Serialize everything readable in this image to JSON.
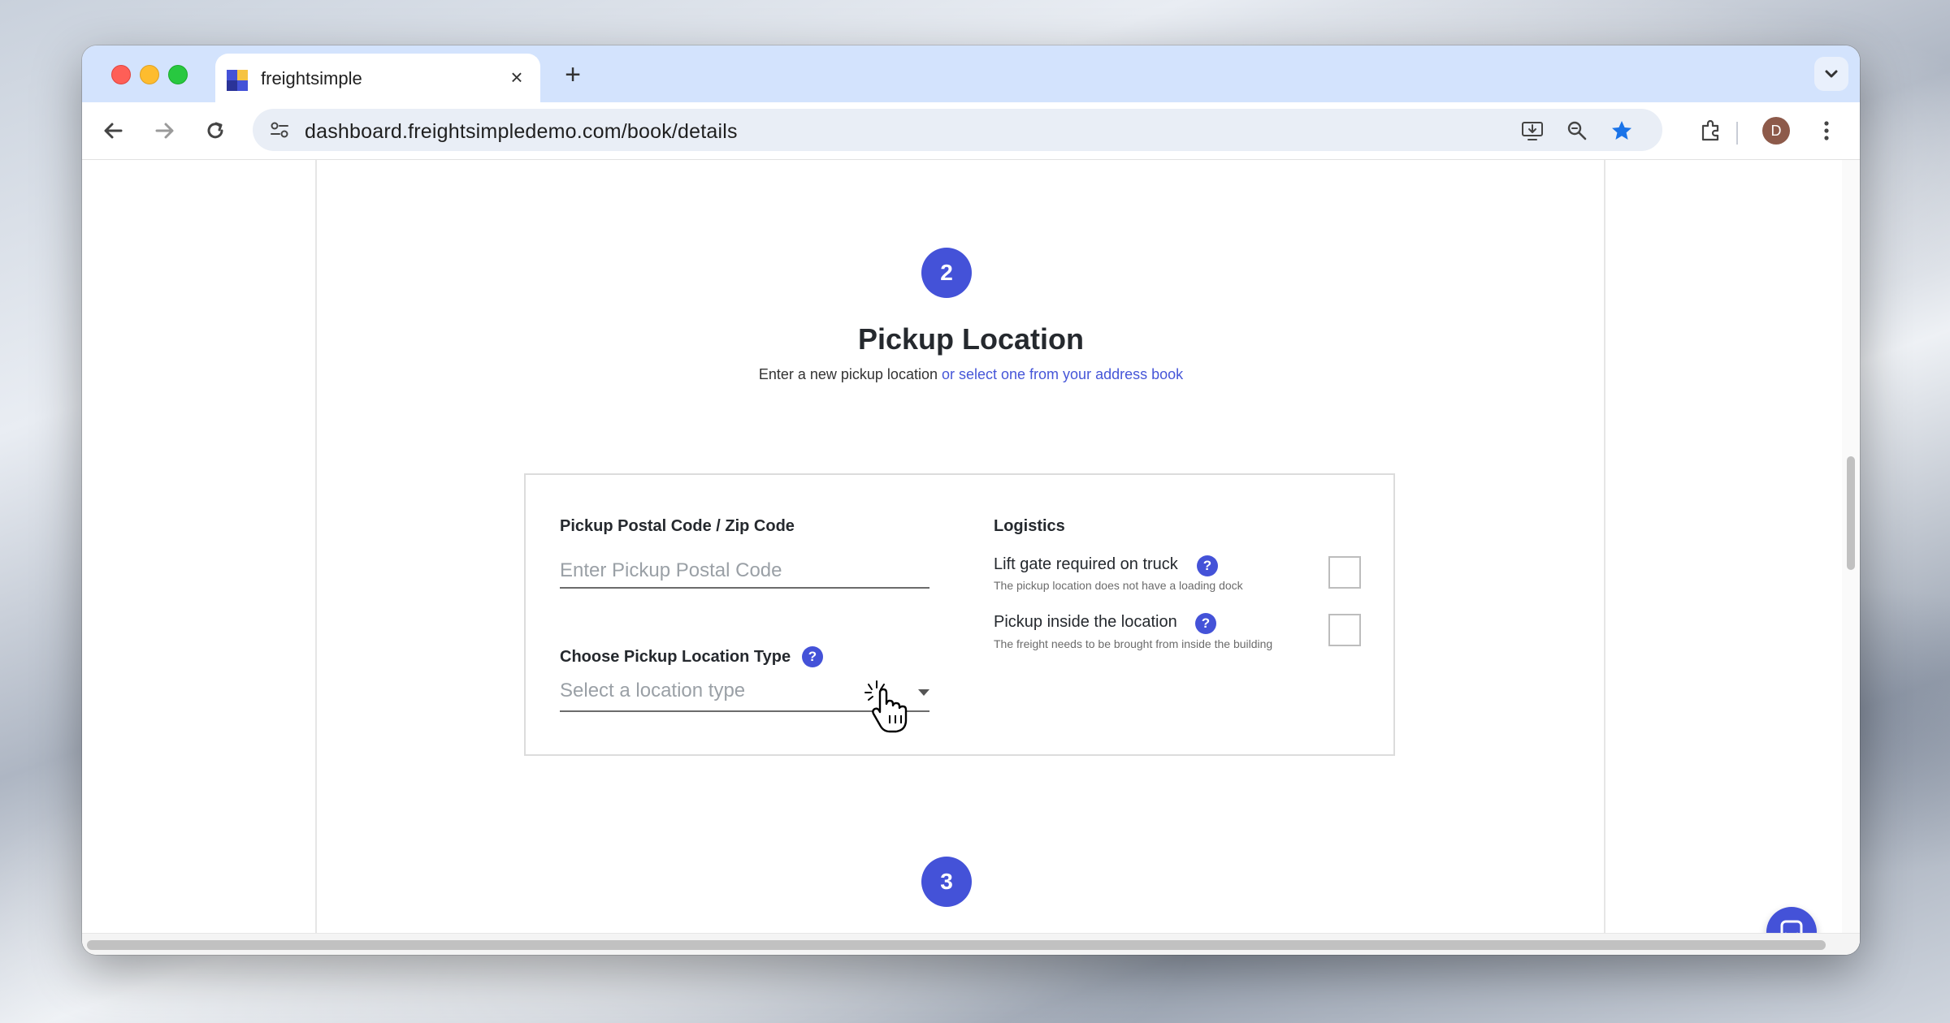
{
  "browser": {
    "tab": {
      "title": "freightsimple",
      "close_glyph": "×"
    },
    "new_tab_glyph": "+",
    "url": "dashboard.freightsimpledemo.com/book/details",
    "avatar_initial": "D"
  },
  "page": {
    "step2": {
      "number": "2",
      "title": "Pickup Location",
      "subtitle_plain": "Enter a new pickup location ",
      "subtitle_link": "or select one from your address book"
    },
    "form": {
      "postal_label": "Pickup Postal Code / Zip Code",
      "postal_placeholder": "Enter Pickup Postal Code",
      "postal_value": "",
      "location_type_label": "Choose Pickup Location Type",
      "location_type_placeholder": "Select a location type",
      "help_glyph": "?"
    },
    "logistics": {
      "title": "Logistics",
      "options": [
        {
          "title": "Lift gate required on truck",
          "description": "The pickup location does not have a loading dock",
          "checked": false
        },
        {
          "title": "Pickup inside the location",
          "description": "The freight needs to be brought from inside the building",
          "checked": false
        }
      ]
    },
    "step3": {
      "number": "3"
    }
  },
  "colors": {
    "accent": "#4452d8",
    "link": "#4656d8",
    "tabbar": "#d3e3fd",
    "bookmark_star": "#1a73e8"
  }
}
